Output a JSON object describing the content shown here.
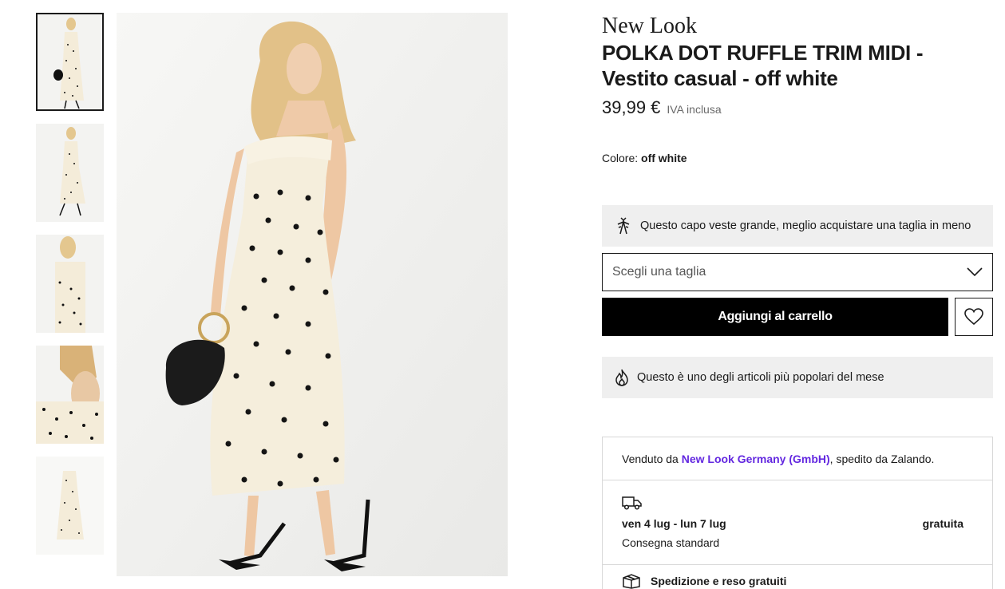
{
  "gallery": {
    "thumbnails": [
      {
        "alt": "view-front-bag",
        "selected": true
      },
      {
        "alt": "view-side",
        "selected": false
      },
      {
        "alt": "view-front-closeup",
        "selected": false
      },
      {
        "alt": "view-back-closeup",
        "selected": false
      },
      {
        "alt": "view-flat",
        "selected": false
      }
    ]
  },
  "product": {
    "brand": "New Look",
    "title_line1": "POLKA DOT RUFFLE TRIM MIDI -",
    "title_line2": "Vestito casual - off white",
    "price": "39,99 €",
    "vat": "IVA inclusa",
    "color_label": "Colore:",
    "color_value": "off white"
  },
  "fit_note": {
    "icon": "size-fit-icon",
    "text": "Questo capo veste grande, meglio acquistare una taglia in meno"
  },
  "size_select": {
    "placeholder": "Scegli una taglia",
    "icon": "chevron-down-icon"
  },
  "actions": {
    "add_to_cart": "Aggiungi al carrello",
    "wishlist_icon": "heart-icon"
  },
  "popular_note": {
    "icon": "flame-icon",
    "text": "Questo è uno degli articoli più popolari del mese"
  },
  "seller": {
    "prefix": "Venduto da ",
    "name": "New Look Germany (GmbH)",
    "suffix": ", spedito da Zalando."
  },
  "delivery": {
    "icon": "truck-icon",
    "dates": "ven 4 lug - lun 7 lug",
    "cost": "gratuita",
    "method": "Consegna standard"
  },
  "shipping_returns": {
    "icon": "box-icon",
    "text": "Spedizione e reso gratuiti"
  },
  "colors": {
    "accent_link": "#6328e0",
    "button_bg": "#000000",
    "note_bg": "#efefef",
    "border": "#d8d8d8"
  }
}
